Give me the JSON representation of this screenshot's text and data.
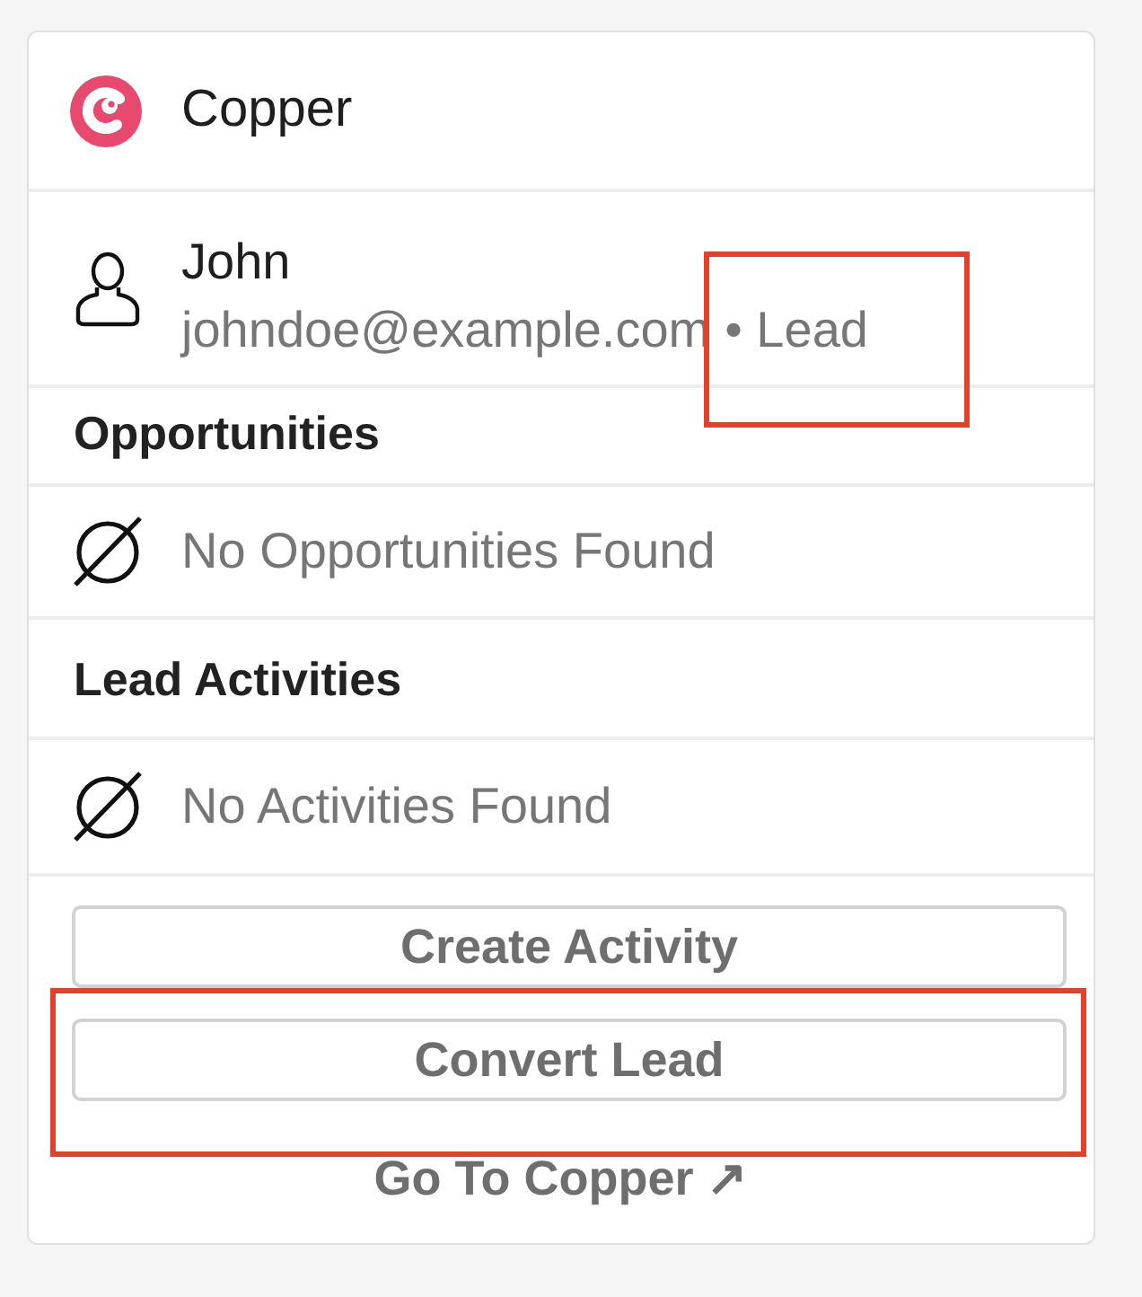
{
  "header": {
    "title": "Copper"
  },
  "contact": {
    "name": "John",
    "email": "johndoe@example.com",
    "status": "• Lead",
    "status_highlighted": true
  },
  "sections": [
    {
      "title": "Opportunities",
      "empty_text": "No Opportunities Found"
    },
    {
      "title": "Lead Activities",
      "empty_text": "No Activities Found"
    }
  ],
  "buttons": [
    {
      "label": "Create Activity",
      "highlighted": false
    },
    {
      "label": "Convert Lead",
      "highlighted": true
    }
  ],
  "link": {
    "label": "Go To Copper ↗"
  }
}
